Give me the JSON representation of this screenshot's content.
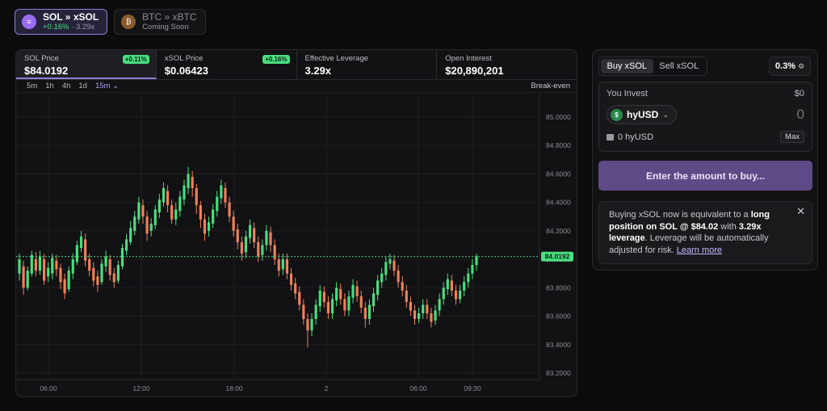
{
  "pairs": [
    {
      "name_a": "SOL",
      "sep": "»",
      "name_b": "xSOL",
      "change": "+0.16%",
      "dot": "·",
      "lev": "3.29x",
      "icon": "sol-logo-icon"
    },
    {
      "name_a": "BTC",
      "sep": "»",
      "name_b": "xBTC",
      "sub": "Coming Soon",
      "icon": "btc-logo-icon"
    }
  ],
  "stats": [
    {
      "label": "SOL Price",
      "value": "$84.0192",
      "badge": "+0.11%"
    },
    {
      "label": "xSOL Price",
      "value": "$0.06423",
      "badge": "+0.16%"
    },
    {
      "label": "Effective Leverage",
      "value": "3.29x"
    },
    {
      "label": "Open Interest",
      "value": "$20,890,201"
    }
  ],
  "intervals": [
    "5m",
    "1h",
    "4h",
    "1d",
    "15m"
  ],
  "active_interval": "15m",
  "breakeven_label": "Break-even",
  "chart_data": {
    "type": "candlestick",
    "current_price": "84.0192",
    "y_ticks": [
      "85.0000",
      "84.8000",
      "84.6000",
      "84.4000",
      "84.2000",
      "84.0000",
      "83.8000",
      "83.6000",
      "83.4000",
      "83.2000"
    ],
    "x_ticks": [
      "06:00",
      "12:00",
      "18:00",
      "2",
      "06:00",
      "09:30"
    ],
    "ylim": [
      83.2,
      85.0
    ],
    "candles": [
      [
        83.9,
        84.0,
        83.85,
        84.04
      ],
      [
        83.95,
        83.8,
        83.75,
        83.99
      ],
      [
        83.8,
        83.92,
        83.78,
        83.95
      ],
      [
        83.9,
        84.03,
        83.88,
        84.06
      ],
      [
        84.0,
        83.92,
        83.88,
        84.05
      ],
      [
        83.92,
        84.02,
        83.89,
        84.06
      ],
      [
        84.0,
        83.85,
        83.82,
        84.04
      ],
      [
        83.88,
        83.94,
        83.84,
        83.98
      ],
      [
        83.9,
        84.01,
        83.86,
        84.04
      ],
      [
        83.99,
        83.93,
        83.88,
        84.03
      ],
      [
        83.94,
        83.84,
        83.79,
        83.97
      ],
      [
        83.86,
        83.76,
        83.72,
        83.9
      ],
      [
        83.79,
        83.92,
        83.77,
        83.95
      ],
      [
        83.9,
        84.0,
        83.86,
        84.04
      ],
      [
        83.98,
        84.1,
        83.96,
        84.13
      ],
      [
        84.08,
        84.16,
        84.05,
        84.2
      ],
      [
        84.14,
        83.99,
        83.95,
        84.18
      ],
      [
        84.0,
        83.92,
        83.88,
        84.04
      ],
      [
        83.94,
        83.85,
        83.81,
        83.98
      ],
      [
        83.88,
        83.82,
        83.77,
        83.92
      ],
      [
        83.84,
        83.97,
        83.82,
        84.0
      ],
      [
        83.95,
        84.02,
        83.91,
        84.06
      ],
      [
        84.0,
        83.89,
        83.85,
        84.03
      ],
      [
        83.9,
        83.84,
        83.8,
        83.94
      ],
      [
        83.85,
        83.96,
        83.83,
        83.99
      ],
      [
        83.95,
        84.08,
        83.93,
        84.11
      ],
      [
        84.06,
        84.14,
        84.03,
        84.18
      ],
      [
        84.12,
        84.22,
        84.1,
        84.27
      ],
      [
        84.2,
        84.3,
        84.17,
        84.34
      ],
      [
        84.28,
        84.4,
        84.25,
        84.44
      ],
      [
        84.38,
        84.3,
        84.25,
        84.42
      ],
      [
        84.3,
        84.18,
        84.13,
        84.34
      ],
      [
        84.2,
        84.25,
        84.16,
        84.29
      ],
      [
        84.24,
        84.35,
        84.21,
        84.38
      ],
      [
        84.33,
        84.42,
        84.29,
        84.46
      ],
      [
        84.4,
        84.5,
        84.37,
        84.54
      ],
      [
        84.48,
        84.38,
        84.33,
        84.52
      ],
      [
        84.38,
        84.28,
        84.25,
        84.42
      ],
      [
        84.28,
        84.35,
        84.24,
        84.4
      ],
      [
        84.34,
        84.44,
        84.3,
        84.48
      ],
      [
        84.42,
        84.52,
        84.38,
        84.56
      ],
      [
        84.5,
        84.6,
        84.46,
        84.65
      ],
      [
        84.58,
        84.5,
        84.44,
        84.62
      ],
      [
        84.5,
        84.38,
        84.32,
        84.53
      ],
      [
        84.38,
        84.28,
        84.22,
        84.41
      ],
      [
        84.28,
        84.18,
        84.13,
        84.32
      ],
      [
        84.2,
        84.26,
        84.16,
        84.3
      ],
      [
        84.25,
        84.35,
        84.22,
        84.39
      ],
      [
        84.34,
        84.44,
        84.3,
        84.48
      ],
      [
        84.43,
        84.52,
        84.39,
        84.56
      ],
      [
        84.5,
        84.4,
        84.36,
        84.54
      ],
      [
        84.4,
        84.3,
        84.26,
        84.44
      ],
      [
        84.3,
        84.2,
        84.16,
        84.34
      ],
      [
        84.21,
        84.12,
        84.07,
        84.25
      ],
      [
        84.12,
        84.04,
        83.99,
        84.16
      ],
      [
        84.05,
        84.16,
        84.01,
        84.2
      ],
      [
        84.15,
        84.24,
        84.11,
        84.28
      ],
      [
        84.22,
        84.12,
        84.08,
        84.26
      ],
      [
        84.12,
        84.02,
        83.98,
        84.16
      ],
      [
        84.03,
        84.1,
        83.99,
        84.14
      ],
      [
        84.1,
        84.2,
        84.06,
        84.24
      ],
      [
        84.19,
        84.1,
        84.05,
        84.23
      ],
      [
        84.1,
        84.0,
        83.96,
        84.14
      ],
      [
        84.0,
        83.92,
        83.88,
        84.04
      ],
      [
        83.93,
        84.0,
        83.89,
        84.04
      ],
      [
        84.0,
        83.9,
        83.86,
        84.04
      ],
      [
        83.9,
        83.82,
        83.78,
        83.94
      ],
      [
        83.83,
        83.76,
        83.72,
        83.87
      ],
      [
        83.77,
        83.68,
        83.64,
        83.81
      ],
      [
        83.68,
        83.58,
        83.54,
        83.72
      ],
      [
        83.58,
        83.5,
        83.38,
        83.62
      ],
      [
        83.5,
        83.58,
        83.46,
        83.62
      ],
      [
        83.58,
        83.68,
        83.54,
        83.72
      ],
      [
        83.67,
        83.78,
        83.63,
        83.82
      ],
      [
        83.77,
        83.7,
        83.66,
        83.81
      ],
      [
        83.7,
        83.62,
        83.58,
        83.74
      ],
      [
        83.62,
        83.72,
        83.58,
        83.76
      ],
      [
        83.71,
        83.8,
        83.67,
        83.84
      ],
      [
        83.79,
        83.72,
        83.68,
        83.83
      ],
      [
        83.72,
        83.64,
        83.6,
        83.76
      ],
      [
        83.64,
        83.74,
        83.6,
        83.78
      ],
      [
        83.73,
        83.82,
        83.69,
        83.86
      ],
      [
        83.81,
        83.74,
        83.7,
        83.85
      ],
      [
        83.74,
        83.66,
        83.62,
        83.78
      ],
      [
        83.66,
        83.58,
        83.52,
        83.7
      ],
      [
        83.58,
        83.68,
        83.54,
        83.72
      ],
      [
        83.67,
        83.76,
        83.63,
        83.8
      ],
      [
        83.75,
        83.85,
        83.71,
        83.89
      ],
      [
        83.84,
        83.9,
        83.8,
        83.94
      ],
      [
        83.89,
        83.98,
        83.85,
        84.02
      ],
      [
        83.97,
        84.0,
        83.93,
        84.04
      ],
      [
        83.99,
        83.92,
        83.88,
        84.03
      ],
      [
        83.92,
        83.84,
        83.8,
        83.96
      ],
      [
        83.84,
        83.78,
        83.74,
        83.88
      ],
      [
        83.78,
        83.7,
        83.66,
        83.82
      ],
      [
        83.7,
        83.64,
        83.6,
        83.74
      ],
      [
        83.64,
        83.58,
        83.54,
        83.68
      ],
      [
        83.58,
        83.62,
        83.55,
        83.66
      ],
      [
        83.62,
        83.68,
        83.58,
        83.72
      ],
      [
        83.68,
        83.62,
        83.58,
        83.72
      ],
      [
        83.62,
        83.56,
        83.52,
        83.66
      ],
      [
        83.57,
        83.64,
        83.54,
        83.68
      ],
      [
        83.64,
        83.72,
        83.6,
        83.76
      ],
      [
        83.72,
        83.8,
        83.68,
        83.84
      ],
      [
        83.79,
        83.86,
        83.75,
        83.9
      ],
      [
        83.85,
        83.78,
        83.74,
        83.89
      ],
      [
        83.78,
        83.72,
        83.68,
        83.82
      ],
      [
        83.72,
        83.78,
        83.69,
        83.82
      ],
      [
        83.78,
        83.84,
        83.74,
        83.88
      ],
      [
        83.84,
        83.9,
        83.8,
        83.94
      ],
      [
        83.9,
        83.96,
        83.86,
        84.0
      ],
      [
        83.96,
        84.02,
        83.92,
        84.04
      ]
    ]
  },
  "trade": {
    "buy_label": "Buy xSOL",
    "sell_label": "Sell xSOL",
    "fee": "0.3%",
    "invest_label": "You Invest",
    "invest_usd": "$0",
    "token": "hyUSD",
    "amount_placeholder": "0",
    "balance": "0 hyUSD",
    "max_label": "Max",
    "cta": "Enter the amount to buy..."
  },
  "info": {
    "p1": "Buying xSOL now is equivalent to a ",
    "b1": "long position on SOL @ $84.02",
    "p2": " with ",
    "b2": "3.29x leverage",
    "p3": ". Leverage will be automatically adjusted for risk. ",
    "link": "Learn more"
  },
  "colors": {
    "up": "#4ade80",
    "down": "#f0805a",
    "accent": "#8b7fd6"
  }
}
